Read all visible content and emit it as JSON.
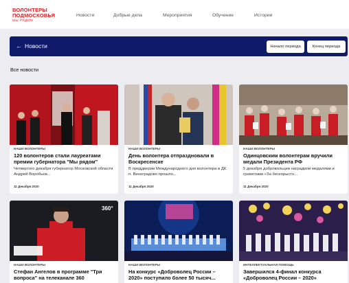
{
  "logo": {
    "line1": "Волонтеры",
    "line2": "Подмосковья",
    "sub": "МЫ РЯДОМ"
  },
  "nav": [
    "Новости",
    "Добрые дела",
    "Мероприятия",
    "Обучение",
    "Истории"
  ],
  "header": {
    "title": "Новости",
    "start_period": "Начало периода",
    "end_period": "Конец периода"
  },
  "section_title": "Все новости",
  "cards": [
    {
      "category": "Наши волонтеры",
      "title": "120 волонтеров стали лауреатами премии губернатора \"Мы рядом\"",
      "text": "Четвертого декабря губернатор Московской области Андрей Воробьев...",
      "date": "11 Декабря 2020"
    },
    {
      "category": "Наши волонтеры",
      "title": "День волонтера отпраздновали в Воскресенске",
      "text": "В преддверии Международного дня волонтера в ДК п. Виноградово прошло...",
      "date": "11 Декабря 2020"
    },
    {
      "category": "Наши волонтеры",
      "title": "Одинцовским волонтерам вручили медали Президента РФ",
      "text": "5 декабря добровольцев наградили медалями и грамотами «За бескорыстн...",
      "date": "11 Декабря 2020"
    },
    {
      "category": "Наши волонтеры",
      "title": "Стефан Ангелов в программе \"Три вопроса\" на телеканале 360",
      "text": "",
      "date": ""
    },
    {
      "category": "Наши волонтеры",
      "title": "На конкурс «Доброволец России – 2020» поступило более 50 тысяч...",
      "text": "",
      "date": ""
    },
    {
      "category": "Интеллектуальная помощь",
      "title": "Завершился 4-финал конкурса «Доброволец России – 2020»",
      "text": "",
      "date": ""
    }
  ],
  "overlay": {
    "tv_logo": "360°"
  }
}
